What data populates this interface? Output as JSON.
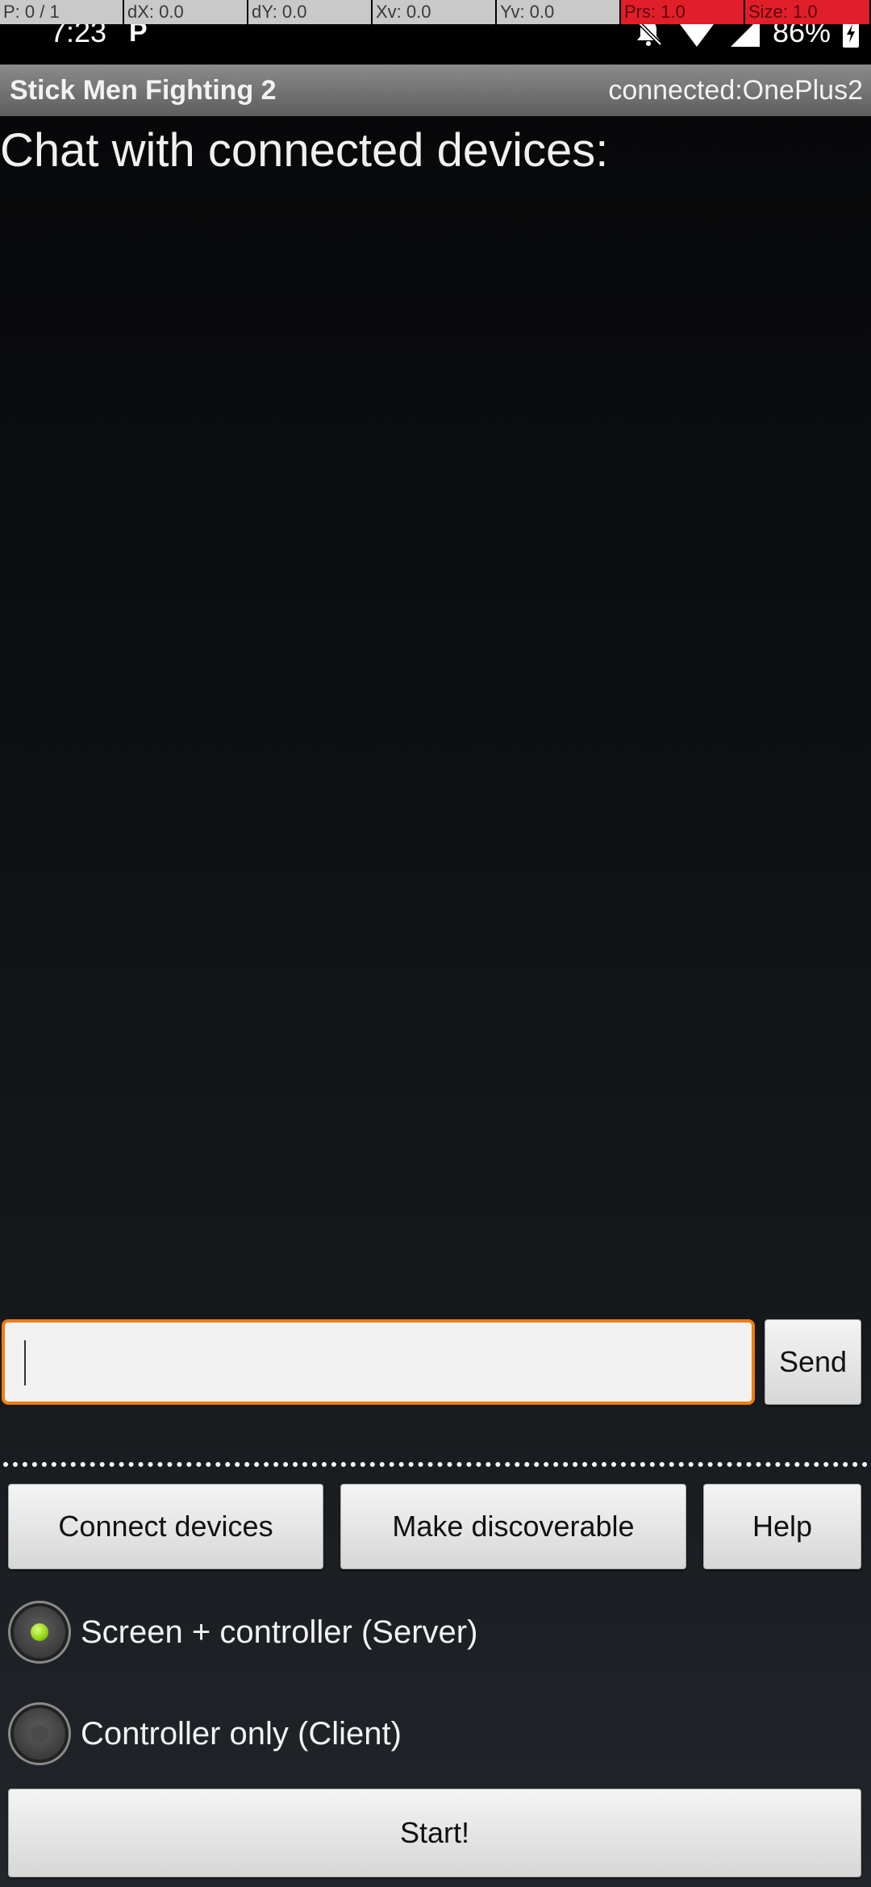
{
  "status_bar": {
    "pointer_overlay": [
      "P: 0 / 1",
      "dX: 0.0",
      "dY: 0.0",
      "Xv: 0.0",
      "Yv: 0.0",
      "Prs: 1.0",
      "Size: 1.0"
    ],
    "time": "7:23",
    "notification_icon": "P",
    "battery": "86%",
    "icons": [
      "bell-off-icon",
      "wifi-icon",
      "signal-icon",
      "battery-charging-icon"
    ]
  },
  "title_bar": {
    "title": "Stick Men Fighting 2",
    "connection_status": "connected:OnePlus2"
  },
  "chat": {
    "heading": "Chat with connected devices:",
    "input_value": "",
    "send_label": "Send"
  },
  "actions": {
    "connect_label": "Connect devices",
    "discoverable_label": "Make discoverable",
    "help_label": "Help"
  },
  "mode": {
    "options": [
      {
        "label": "Screen + controller (Server)",
        "checked": true
      },
      {
        "label": "Controller only (Client)",
        "checked": false
      }
    ]
  },
  "start_label": "Start!",
  "colors": {
    "input_border": "#ef7d12",
    "radio_selected": "#8fd414"
  }
}
